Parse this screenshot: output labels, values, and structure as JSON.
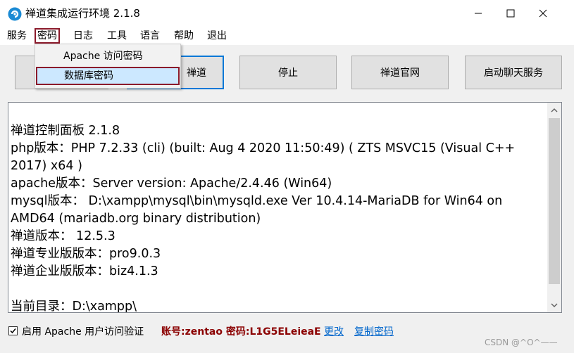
{
  "window": {
    "title": "禅道集成运行环境 2.1.8",
    "app_icon": "zentao-logo-icon",
    "controls": {
      "minimize": "minimize-icon",
      "maximize": "maximize-icon",
      "close": "close-icon"
    }
  },
  "menubar": {
    "items": [
      {
        "label": "服务"
      },
      {
        "label": "密码"
      },
      {
        "label": "日志"
      },
      {
        "label": "工具"
      },
      {
        "label": "语言"
      },
      {
        "label": "帮助"
      },
      {
        "label": "退出"
      }
    ],
    "active": "密码"
  },
  "dropdown": {
    "items": [
      {
        "label": "Apache 访问密码"
      },
      {
        "label": "数据库密码"
      }
    ],
    "highlighted": "数据库密码"
  },
  "buttons": {
    "hidden_first": "",
    "access_zentao_partial": "禅道",
    "stop": "停止",
    "official_site": "禅道官网",
    "start_chat": "启动聊天服务"
  },
  "console": {
    "lines": [
      "禅道控制面板 2.1.8",
      "php版本：PHP 7.2.33 (cli) (built: Aug  4 2020 11:50:49) ( ZTS MSVC15 (Visual C++ 2017) x64 )",
      "apache版本：Server version: Apache/2.4.46 (Win64)",
      "mysql版本： D:\\xampp\\mysql\\bin\\mysqld.exe  Ver 10.4.14-MariaDB for Win64 on AMD64 (mariadb.org binary distribution)",
      "禅道版本： 12.5.3",
      "禅道专业版版本：pro9.0.3",
      "禅道企业版版本：biz4.1.3",
      "",
      "当前目录：D:\\xampp\\"
    ]
  },
  "footer": {
    "checkbox_checked": true,
    "checkbox_label": "启用 Apache 用户访问验证",
    "account_text": "账号:zentao 密码:L1G5ELeieaE",
    "change_link": "更改",
    "copy_link": "复制密码"
  },
  "watermark": "CSDN @^O^——",
  "colors": {
    "accent_border": "#8b1a2b",
    "focus_blue": "#0078d7",
    "link_blue": "#0066cc",
    "account_red": "#8b0000"
  }
}
